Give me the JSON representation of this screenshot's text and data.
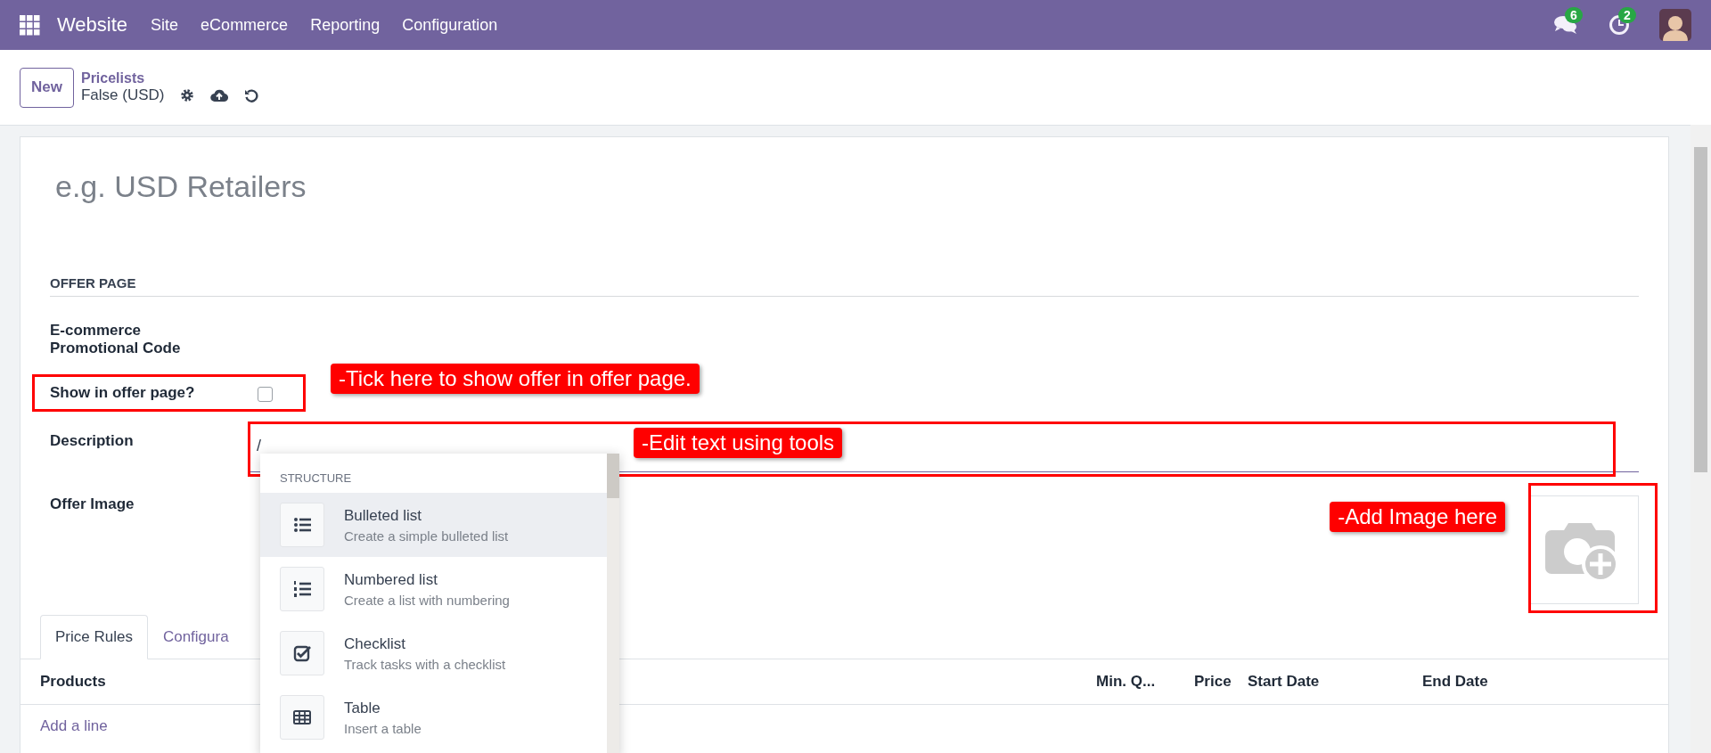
{
  "navbar": {
    "app_name": "Website",
    "menu": [
      "Site",
      "eCommerce",
      "Reporting",
      "Configuration"
    ],
    "messages_badge": "6",
    "activities_badge": "2"
  },
  "control_panel": {
    "new_button": "New",
    "breadcrumb": "Pricelists",
    "record": "False (USD)"
  },
  "form": {
    "name_placeholder": "e.g. USD Retailers",
    "section_title": "OFFER PAGE",
    "fields": [
      {
        "kind": "text",
        "label": "E-commerce Promotional Code"
      },
      {
        "kind": "checkbox",
        "label": "Show in offer page?",
        "checked": false,
        "annotation": "-Tick here to show offer in offer page."
      },
      {
        "kind": "html",
        "label": "Description",
        "value": "/",
        "annotation": "-Edit text using tools"
      },
      {
        "kind": "image",
        "label": "Offer Image",
        "annotation": "-Add Image here"
      }
    ]
  },
  "tabs": [
    {
      "label": "Price Rules",
      "selected": true
    },
    {
      "label": "Configura",
      "selected": false
    }
  ],
  "table": {
    "columns": [
      "Products",
      "Min. Q...",
      "Price",
      "Start Date",
      "End Date"
    ],
    "add_line": "Add a line"
  },
  "command_menu": {
    "group": "STRUCTURE",
    "items": [
      {
        "kind": "bulleted",
        "title": "Bulleted list",
        "description": "Create a simple bulleted list",
        "selected": true
      },
      {
        "kind": "numbered",
        "title": "Numbered list",
        "description": "Create a list with numbering",
        "selected": false
      },
      {
        "kind": "checklist",
        "title": "Checklist",
        "description": "Track tasks with a checklist",
        "selected": false
      },
      {
        "kind": "table",
        "title": "Table",
        "description": "Insert a table",
        "selected": false
      }
    ]
  }
}
